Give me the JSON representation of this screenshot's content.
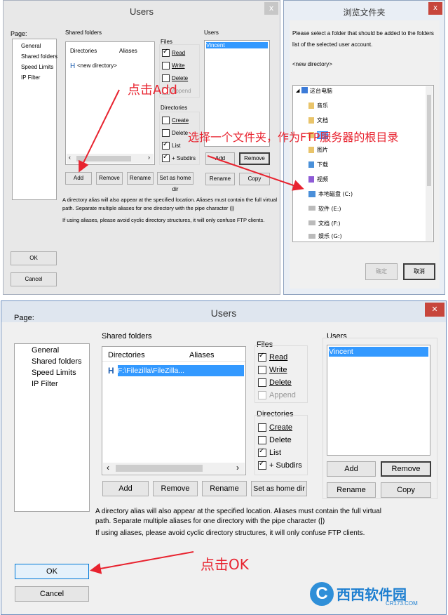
{
  "top_dialog": {
    "title": "Users",
    "close_glyph": "x",
    "page_label": "Page:",
    "pages": [
      "General",
      "Shared folders",
      "Speed Limits",
      "IP Filter"
    ],
    "shared_folders_label": "Shared folders",
    "col_directories": "Directories",
    "col_aliases": "Aliases",
    "row_marker": "H",
    "row_value": "<new directory>",
    "files_label": "Files",
    "files": {
      "read": "Read",
      "write": "Write",
      "delete": "Delete",
      "append": "Append"
    },
    "directories_label": "Directories",
    "dirs": {
      "create": "Create",
      "delete": "Delete",
      "list": "List",
      "subdirs": "+ Subdirs"
    },
    "users_label": "Users",
    "user": "Vincent",
    "buttons": {
      "add": "Add",
      "remove": "Remove",
      "rename": "Rename",
      "set_home": "Set as home dir",
      "user_add": "Add",
      "user_remove": "Remove",
      "user_rename": "Rename",
      "user_copy": "Copy",
      "ok": "OK",
      "cancel": "Cancel"
    },
    "note1": "A directory alias will also appear at the specified location. Aliases must contain the full virtual",
    "note2": "path. Separate multiple aliases for one directory with the pipe character (|)",
    "note3": "If using aliases, please avoid cyclic directory structures, it will only confuse FTP clients."
  },
  "browse_dialog": {
    "title": "浏览文件夹",
    "close_glyph": "x",
    "desc1": "Please select a folder that should be added to the folders",
    "desc2": "list of the selected user account.",
    "current": "<new directory>",
    "tree": [
      "这台电脑",
      "音乐",
      "文档",
      "图片",
      "图片",
      "下载",
      "视频",
      "本地磁盘 (C:)",
      "软件 (E:)",
      "文档 (F:)",
      "娱乐 (G:)"
    ],
    "ok": "确定",
    "cancel": "取消"
  },
  "bottom_dialog": {
    "title": "Users",
    "close_glyph": "✕",
    "page_label": "Page:",
    "pages": [
      "General",
      "Shared folders",
      "Speed Limits",
      "IP Filter"
    ],
    "shared_folders_label": "Shared folders",
    "col_directories": "Directories",
    "col_aliases": "Aliases",
    "row_marker": "H",
    "row_value": "F:\\Filezilla\\FileZilla...",
    "files_label": "Files",
    "files": {
      "read": "Read",
      "write": "Write",
      "delete": "Delete",
      "append": "Append"
    },
    "directories_label": "Directories",
    "dirs": {
      "create": "Create",
      "delete": "Delete",
      "list": "List",
      "subdirs": "+ Subdirs"
    },
    "users_label": "Users",
    "user": "Vincent",
    "buttons": {
      "add": "Add",
      "remove": "Remove",
      "rename": "Rename",
      "set_home": "Set as home dir",
      "user_add": "Add",
      "user_remove": "Remove",
      "user_rename": "Rename",
      "user_copy": "Copy",
      "ok": "OK",
      "cancel": "Cancel"
    },
    "note1": "A directory alias will also appear at the specified location. Aliases must contain the full virtual",
    "note2": "path. Separate multiple aliases for one directory with the pipe character (|)",
    "note3": "If using aliases, please avoid cyclic directory structures, it will only confuse FTP clients."
  },
  "annotations": {
    "click_add": "点击Add",
    "choose_folder": "选择一个文件夹，作为FTP服务器的根目录",
    "click_ok": "点击OK"
  },
  "watermark": {
    "text": "西西软件园",
    "url": "CR173.COM"
  },
  "colors": {
    "annotation": "#e8232f",
    "selection": "#3399ff",
    "close_red": "#c7463c"
  }
}
